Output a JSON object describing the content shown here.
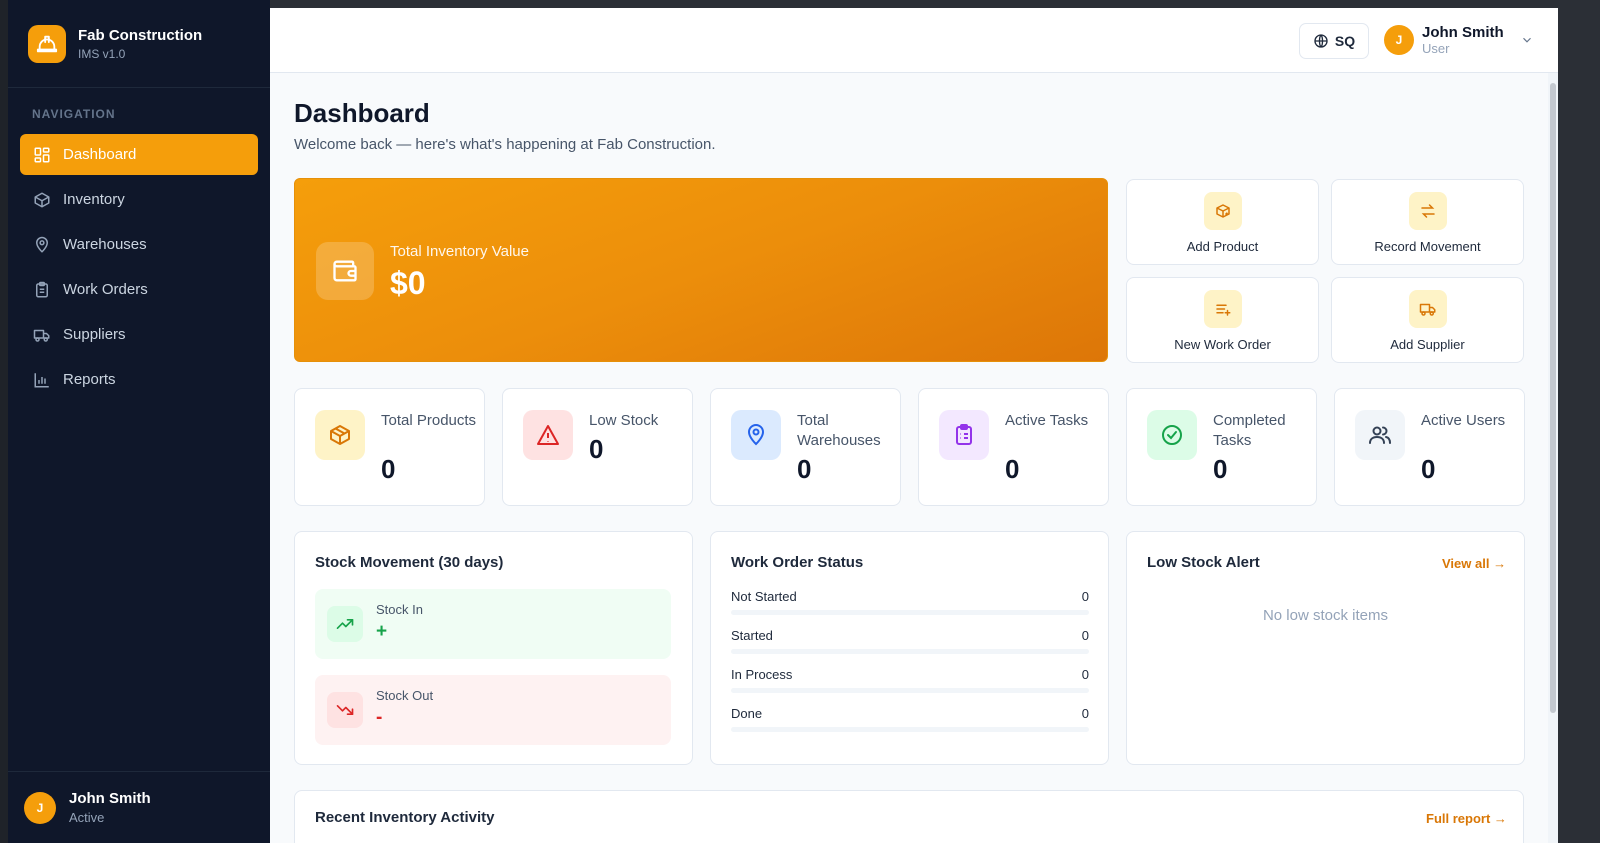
{
  "brand": {
    "name": "Fab Construction",
    "version": "IMS v1.0"
  },
  "sidebar": {
    "heading": "NAVIGATION",
    "items": [
      {
        "label": "Dashboard",
        "icon": "grid-icon",
        "active": true
      },
      {
        "label": "Inventory",
        "icon": "box-icon"
      },
      {
        "label": "Warehouses",
        "icon": "map-pin-icon"
      },
      {
        "label": "Work Orders",
        "icon": "clipboard-icon"
      },
      {
        "label": "Suppliers",
        "icon": "truck-icon"
      },
      {
        "label": "Reports",
        "icon": "bar-chart-icon"
      }
    ],
    "user": {
      "initial": "J",
      "name": "John Smith",
      "status": "Active"
    }
  },
  "topbar": {
    "language": "SQ",
    "user": {
      "initial": "J",
      "name": "John Smith",
      "role": "User"
    }
  },
  "page": {
    "title": "Dashboard",
    "subtitle": "Welcome back — here's what's happening at Fab Construction."
  },
  "hero": {
    "label": "Total Inventory Value",
    "value": "$0"
  },
  "quick_actions": [
    {
      "label": "Add Product",
      "icon": "package-plus-icon"
    },
    {
      "label": "Record Movement",
      "icon": "arrows-exchange-icon"
    },
    {
      "label": "New Work Order",
      "icon": "list-plus-icon"
    },
    {
      "label": "Add Supplier",
      "icon": "truck-icon"
    }
  ],
  "stats": [
    {
      "label": "Total Products",
      "value": "0",
      "icon": "box-icon"
    },
    {
      "label": "Low Stock",
      "value": "0",
      "icon": "warning-icon"
    },
    {
      "label": "Total Warehouses",
      "value": "0",
      "icon": "map-pin-icon"
    },
    {
      "label": "Active Tasks",
      "value": "0",
      "icon": "clipboard-list-icon"
    },
    {
      "label": "Completed Tasks",
      "value": "0",
      "icon": "check-circle-icon"
    },
    {
      "label": "Active Users",
      "value": "0",
      "icon": "users-icon"
    }
  ],
  "stock_movement": {
    "title": "Stock Movement (30 days)",
    "in": {
      "label": "Stock In",
      "value": "+"
    },
    "out": {
      "label": "Stock Out",
      "value": "-"
    }
  },
  "work_order_status": {
    "title": "Work Order Status",
    "rows": [
      {
        "label": "Not Started",
        "count": "0",
        "fraction": 0
      },
      {
        "label": "Started",
        "count": "0",
        "fraction": 0
      },
      {
        "label": "In Process",
        "count": "0",
        "fraction": 0
      },
      {
        "label": "Done",
        "count": "0",
        "fraction": 0
      }
    ]
  },
  "low_stock": {
    "title": "Low Stock Alert",
    "link": "View all →",
    "empty": "No low stock items"
  },
  "recent": {
    "title": "Recent Inventory Activity",
    "link": "Full report →"
  },
  "colors": {
    "accent": "#f59e0b",
    "sidebar": "#0f172a",
    "success": "#16a34a",
    "danger": "#dc2626"
  }
}
